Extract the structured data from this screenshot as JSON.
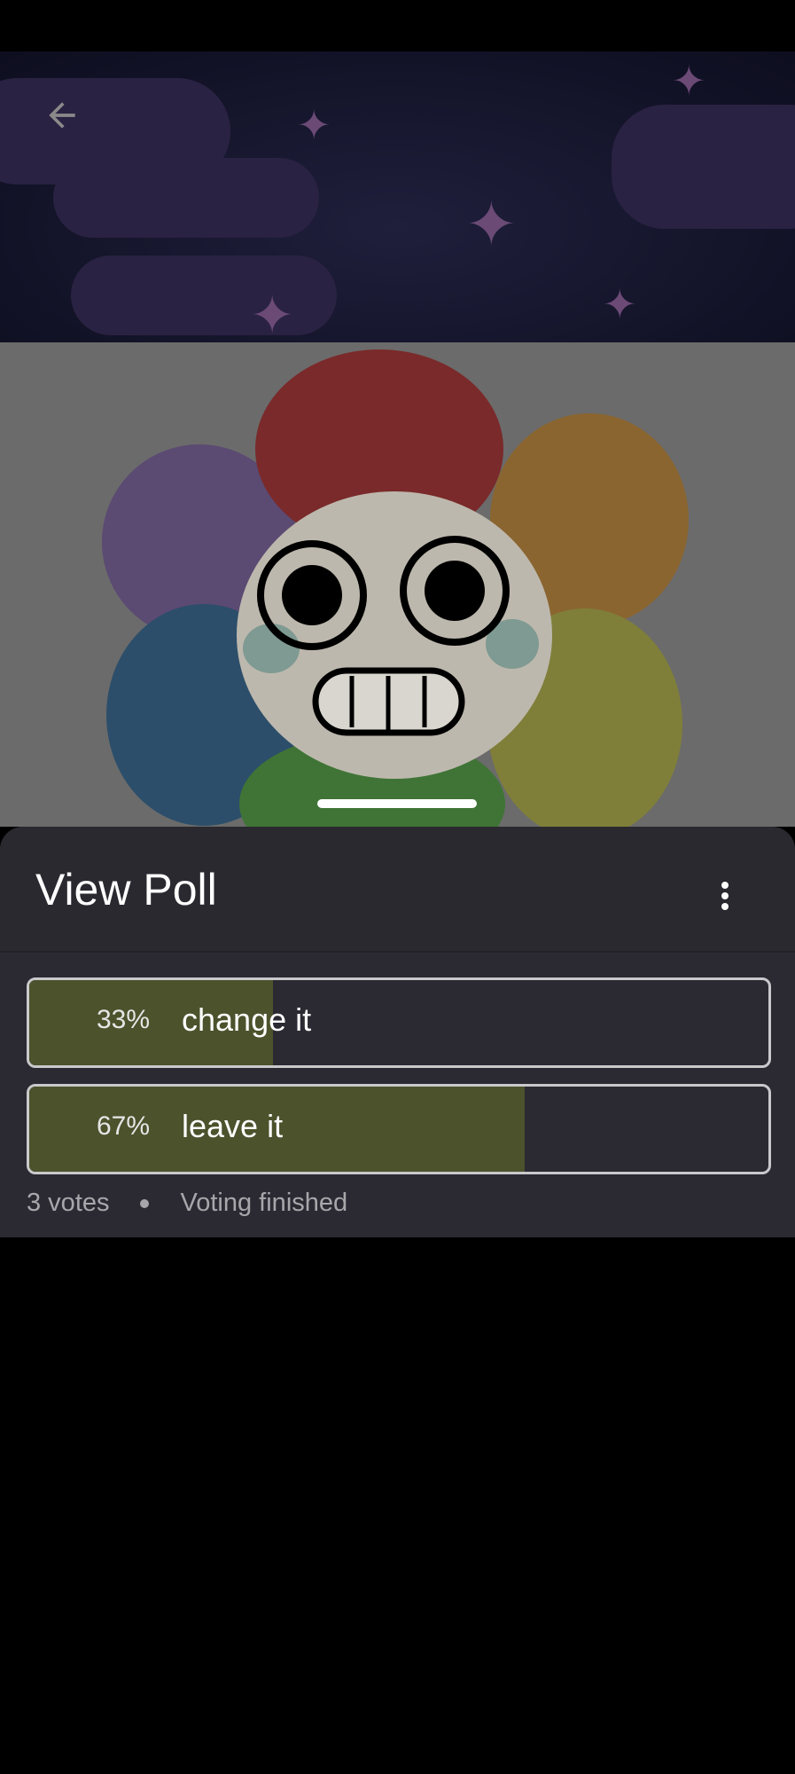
{
  "banner": {
    "back_icon": "arrow-left-icon"
  },
  "photo": {
    "subject": "rainbow flower plush"
  },
  "sheet": {
    "title": "View Poll",
    "more_icon": "more-vertical-icon"
  },
  "poll": {
    "options": [
      {
        "percent_label": "33%",
        "label": "change it",
        "fraction": 0.33
      },
      {
        "percent_label": "67%",
        "label": "leave it",
        "fraction": 0.67
      }
    ],
    "votes": "3 votes",
    "status": "Voting finished"
  },
  "colors": {
    "sheet_bg": "#2b2a33",
    "fill": "#4c522c",
    "border": "#c9c9cc"
  }
}
